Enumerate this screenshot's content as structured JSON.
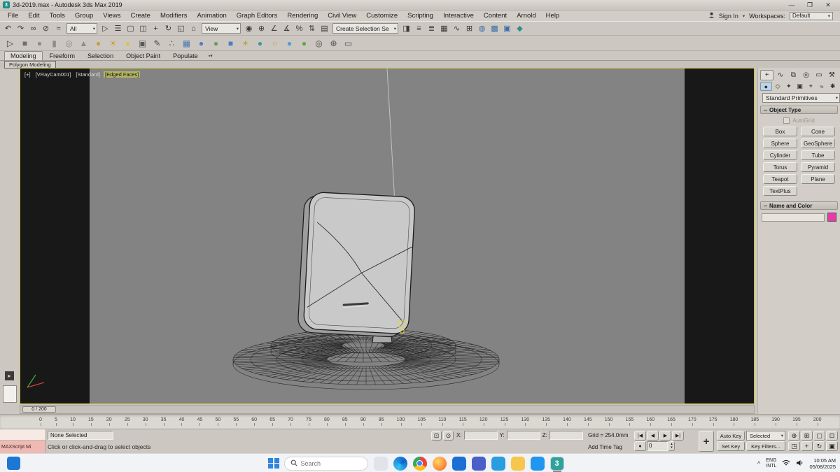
{
  "glyphs": {
    "caret": "▾",
    "spin_up": "▴",
    "spin_down": "▾"
  },
  "titlebar": {
    "app_glyph": "3",
    "title": "3d-2019.max - Autodesk 3ds Max 2019",
    "minimize_glyph": "—",
    "maximize_glyph": "❐",
    "close_glyph": "✕"
  },
  "menubar": {
    "items": [
      "File",
      "Edit",
      "Tools",
      "Group",
      "Views",
      "Create",
      "Modifiers",
      "Animation",
      "Graph Editors",
      "Rendering",
      "Civil View",
      "Customize",
      "Scripting",
      "Interactive",
      "Content",
      "Arnold",
      "Help"
    ],
    "sign_in": "Sign In",
    "workspaces_label": "Workspaces:",
    "workspace_value": "Default"
  },
  "toolbar1": {
    "group_a": [
      {
        "name": "undo-button",
        "glyph": "↶"
      },
      {
        "name": "redo-button",
        "glyph": "↷"
      },
      {
        "name": "select-and-link-button",
        "glyph": "∞"
      },
      {
        "name": "unlink-selection-button",
        "glyph": "⊘"
      },
      {
        "name": "bind-to-space-warp-button",
        "glyph": "≈"
      }
    ],
    "filter_value": "All",
    "group_b": [
      {
        "name": "select-object-button",
        "glyph": "▷"
      },
      {
        "name": "select-by-name-button",
        "glyph": "☰"
      },
      {
        "name": "rectangular-selection-region-button",
        "glyph": "▢"
      },
      {
        "name": "window-crossing-toggle",
        "glyph": "◫"
      },
      {
        "name": "select-and-move-button",
        "glyph": "+"
      },
      {
        "name": "select-and-rotate-button",
        "glyph": "↻"
      },
      {
        "name": "select-and-scale-button",
        "glyph": "◱"
      },
      {
        "name": "select-and-place-button",
        "glyph": "⌂"
      }
    ],
    "coord_value": "View",
    "group_c": [
      {
        "name": "use-pivot-point-center-button",
        "glyph": "◉"
      },
      {
        "name": "select-and-manipulate-button",
        "glyph": "⊕"
      },
      {
        "name": "snaps-toggle",
        "glyph": "∠"
      },
      {
        "name": "angle-snap-toggle",
        "glyph": "∡"
      },
      {
        "name": "percent-snap-toggle",
        "glyph": "%"
      },
      {
        "name": "spinner-snap-toggle",
        "glyph": "⇅"
      },
      {
        "name": "edit-named-selection-sets-button",
        "glyph": "▤"
      }
    ],
    "named_value": "Create Selection Se",
    "group_d": [
      {
        "name": "mirror-button",
        "glyph": "◨"
      },
      {
        "name": "align-button",
        "glyph": "≡"
      },
      {
        "name": "toggle-scene-explorer-button",
        "glyph": "≣"
      },
      {
        "name": "toggle-ribbon-button",
        "glyph": "▦"
      },
      {
        "name": "curve-editor-button",
        "glyph": "∿"
      },
      {
        "name": "schematic-view-button",
        "glyph": "⊞"
      },
      {
        "name": "material-editor-button",
        "glyph": "◍",
        "color": "#3a6ea8"
      },
      {
        "name": "render-setup-button",
        "glyph": "▩",
        "color": "#3a6ea8"
      },
      {
        "name": "rendered-frame-window-button",
        "glyph": "▣",
        "color": "#3a6ea8"
      },
      {
        "name": "render-production-button",
        "glyph": "◆",
        "color": "#2f8f8f"
      }
    ]
  },
  "toolbar2": {
    "icons": [
      {
        "name": "selection-tool-icon",
        "glyph": "▷",
        "color": "#3c3c3c"
      },
      {
        "name": "box-primitive-icon",
        "glyph": "■",
        "color": "#707070"
      },
      {
        "name": "sphere-primitive-icon",
        "glyph": "●",
        "color": "#8c8c8c"
      },
      {
        "name": "cylinder-primitive-icon",
        "glyph": "▮",
        "color": "#8c8c8c"
      },
      {
        "name": "torus-primitive-icon",
        "glyph": "◎",
        "color": "#8c8c8c"
      },
      {
        "name": "cone-primitive-icon",
        "glyph": "▲",
        "color": "#8c8c8c"
      },
      {
        "name": "teapot-icon",
        "glyph": "●",
        "color": "#c59f3f"
      },
      {
        "name": "sun-icon",
        "glyph": "☀",
        "color": "#d39a33"
      },
      {
        "name": "light-icon",
        "glyph": "●",
        "color": "#e2c048"
      },
      {
        "name": "camera-icon",
        "glyph": "▣",
        "color": "#5a5a5a"
      },
      {
        "name": "paint-icon",
        "glyph": "✎",
        "color": "#4a4a4a"
      },
      {
        "name": "spray-icon",
        "glyph": "∴",
        "color": "#4a4a4a"
      },
      {
        "name": "grid-icon",
        "glyph": "▦",
        "color": "#4e79b4"
      },
      {
        "name": "sphere-blue-icon",
        "glyph": "●",
        "color": "#4d7ec4"
      },
      {
        "name": "sphere-green-icon",
        "glyph": "●",
        "color": "#5aa05a"
      },
      {
        "name": "cube-blue-icon",
        "glyph": "■",
        "color": "#4d7ec4"
      },
      {
        "name": "star-icon",
        "glyph": "✶",
        "color": "#c59f3f"
      },
      {
        "name": "globe-icon",
        "glyph": "●",
        "color": "#3a9aa2"
      },
      {
        "name": "ring-icon",
        "glyph": "○",
        "color": "#c59f3f"
      },
      {
        "name": "drop-icon",
        "glyph": "●",
        "color": "#4d9ed2"
      },
      {
        "name": "leaf-icon",
        "glyph": "●",
        "color": "#63a24b"
      },
      {
        "name": "target-icon",
        "glyph": "◎",
        "color": "#4a4a4a"
      },
      {
        "name": "gear-icon",
        "glyph": "⊛",
        "color": "#4a4a4a"
      },
      {
        "name": "monitor-icon",
        "glyph": "▭",
        "color": "#4a4a4a"
      }
    ]
  },
  "ribbon": {
    "tabs": [
      {
        "name": "tab-modeling",
        "label": "Modeling",
        "cls": "active"
      },
      {
        "name": "tab-freeform",
        "label": "Freeform"
      },
      {
        "name": "tab-selection",
        "label": "Selection"
      },
      {
        "name": "tab-object-paint",
        "label": "Object Paint"
      },
      {
        "name": "tab-populate",
        "label": "Populate"
      }
    ],
    "overflow_glyph": "▪▾",
    "panel_label": "Polygon Modeling"
  },
  "viewport": {
    "labels": [
      {
        "name": "viewport-menu-general",
        "text": "[+]"
      },
      {
        "name": "viewport-menu-pov",
        "text": "[VRayCam001]"
      },
      {
        "name": "viewport-menu-shading",
        "text": "[Standard]"
      },
      {
        "name": "viewport-menu-edged-faces",
        "text": "[Edged Faces]",
        "cls": "hl"
      }
    ]
  },
  "command_panel": {
    "tabs": [
      {
        "name": "create-tab",
        "glyph": "+",
        "cls": "active"
      },
      {
        "name": "modify-tab",
        "glyph": "∿"
      },
      {
        "name": "hierarchy-tab",
        "glyph": "⧉"
      },
      {
        "name": "motion-tab",
        "glyph": "◎"
      },
      {
        "name": "display-tab",
        "glyph": "▭"
      },
      {
        "name": "utilities-tab",
        "glyph": "⚒"
      }
    ],
    "subtabs": [
      {
        "name": "geometry-subtab",
        "glyph": "●",
        "cls": "active"
      },
      {
        "name": "shapes-subtab",
        "glyph": "◇"
      },
      {
        "name": "lights-subtab",
        "glyph": "✦"
      },
      {
        "name": "cameras-subtab",
        "glyph": "▣"
      },
      {
        "name": "helpers-subtab",
        "glyph": "⌖"
      },
      {
        "name": "space-warps-subtab",
        "glyph": "≈"
      },
      {
        "name": "systems-subtab",
        "glyph": "✱"
      }
    ],
    "category_value": "Standard Primitives",
    "object_type_title": "Object Type",
    "autogrid_label": "AutoGrid",
    "primitive_buttons": [
      "Box",
      "Cone",
      "Sphere",
      "GeoSphere",
      "Cylinder",
      "Tube",
      "Torus",
      "Pyramid",
      "Teapot",
      "Plane",
      "TextPlus"
    ],
    "name_color_title": "Name and Color",
    "object_color": "#e83aa8"
  },
  "timeline": {
    "slider_label": "0 / 200",
    "ticks": [
      0,
      5,
      10,
      15,
      20,
      25,
      30,
      35,
      40,
      45,
      50,
      55,
      60,
      65,
      70,
      75,
      80,
      85,
      90,
      95,
      100,
      105,
      110,
      115,
      120,
      125,
      130,
      135,
      140,
      145,
      150,
      155,
      160,
      165,
      170,
      175,
      180,
      185,
      190,
      195,
      200
    ]
  },
  "status": {
    "minilistener_label": "MAXScript Mi",
    "selection": "None Selected",
    "prompt": "Click or click-and-drag to select objects",
    "toggles": [
      {
        "name": "isolate-selection-toggle",
        "glyph": "⊡"
      },
      {
        "name": "selection-lock-toggle",
        "glyph": "⊙"
      }
    ],
    "x_label": "X:",
    "x_value": "",
    "y_label": "Y:",
    "y_value": "",
    "z_label": "Z:",
    "z_value": "",
    "grid_label": "Grid = 254.0mm",
    "add_time_tag": "Add Time Tag",
    "transport_icons": [
      {
        "name": "go-to-start-button",
        "glyph": "|◀"
      },
      {
        "name": "previous-frame-button",
        "glyph": "◀"
      },
      {
        "name": "play-button",
        "glyph": "▶"
      },
      {
        "name": "go-to-end-button",
        "glyph": "▶|"
      }
    ],
    "key_mode_glyph": "●",
    "frame_value": "0",
    "pan_glyph": "+",
    "auto_key": "Auto Key",
    "set_key": "Set Key",
    "selection_set": "Selected",
    "key_filters": "Key Filters...",
    "nav_icons": [
      {
        "name": "zoom-button",
        "glyph": "⊕"
      },
      {
        "name": "zoom-all-button",
        "glyph": "⊞"
      },
      {
        "name": "zoom-extents-button",
        "glyph": "▢"
      },
      {
        "name": "zoom-extents-all-button",
        "glyph": "⊡"
      },
      {
        "name": "zoom-region-button",
        "glyph": "◳"
      },
      {
        "name": "pan-view-button",
        "glyph": "+"
      },
      {
        "name": "orbit-button",
        "glyph": "↻"
      },
      {
        "name": "maximize-viewport-toggle",
        "glyph": "▣"
      }
    ]
  },
  "taskbar": {
    "search_placeholder": "Search",
    "apps": [
      {
        "name": "copilot-icon",
        "color": "#dfe3ea",
        "glyph": ""
      },
      {
        "name": "edge-icon",
        "cls": "edge",
        "glyph": ""
      },
      {
        "name": "chrome-icon",
        "cls": "chrome",
        "glyph": ""
      },
      {
        "name": "firefox-icon",
        "cls": "firefox",
        "glyph": ""
      },
      {
        "name": "outlook-icon",
        "color": "#1a6fd4",
        "glyph": ""
      },
      {
        "name": "teams-icon",
        "color": "#4a5fc8",
        "glyph": ""
      },
      {
        "name": "photos-icon",
        "color": "#2a9de0",
        "glyph": ""
      },
      {
        "name": "folder-icon",
        "color": "#f7c64c",
        "glyph": ""
      },
      {
        "name": "vscode-icon",
        "color": "#2196f0",
        "glyph": ""
      },
      {
        "name": "3ds-max-icon",
        "color": "#2fa39b",
        "glyph": "3",
        "cls": "active"
      }
    ],
    "tray": {
      "lang1": "ENG",
      "lang2": "INTL",
      "time": "10:05 AM",
      "date": "05/08/2025"
    }
  }
}
